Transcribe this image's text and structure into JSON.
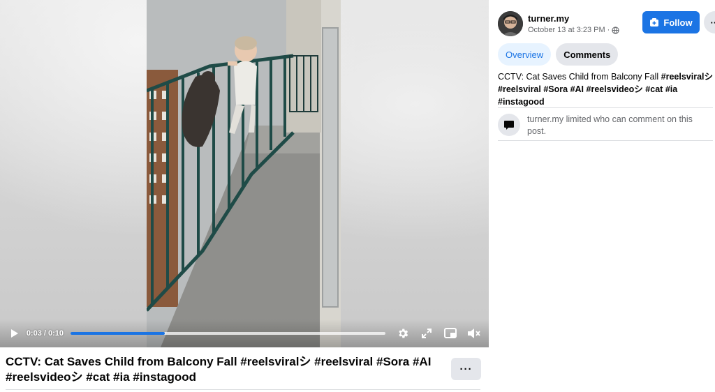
{
  "video": {
    "current_time": "0:03",
    "separator": " / ",
    "duration": "0:10",
    "progress_fraction": 0.3
  },
  "post": {
    "title": "CCTV: Cat Saves Child from Balcony Fall #reelsviralシ #reelsviral #Sora #AI #reelsvideoシ #cat #ia #instagood",
    "more_label": "···"
  },
  "author": {
    "name": "turner.my",
    "date": "October 13 at 3:23 PM",
    "date_separator": "·",
    "privacy_icon": "globe-icon",
    "follow_label": "Follow",
    "more_label": "···"
  },
  "tabs": [
    {
      "label": "Overview",
      "active": true
    },
    {
      "label": "Comments",
      "active": false
    }
  ],
  "caption": {
    "text": "CCTV: Cat Saves Child from Balcony Fall",
    "tags": [
      "#reelsviralシ",
      "#reelsviral",
      "#Sora",
      "#AI",
      "#reelsvideoシ",
      "#cat",
      "#ia",
      "#instagood"
    ]
  },
  "comment_notice": {
    "icon": "speech-bubble-icon",
    "text": "turner.my limited who can comment on this post."
  },
  "colors": {
    "accent": "#1b74e4",
    "tab_active_bg": "#e7f3ff",
    "button_gray": "#e4e6eb",
    "secondary_text": "#65676b"
  }
}
